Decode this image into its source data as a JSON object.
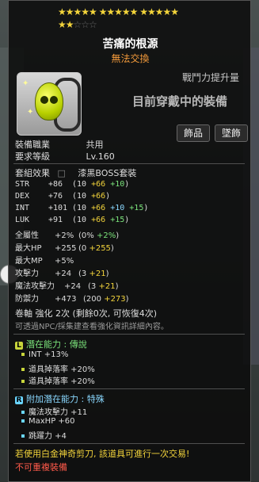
{
  "stars": {
    "row1": "★★★★★  ★★★★★  ★★★★★",
    "row2_filled": "★★",
    "row2_dim": "☆☆☆"
  },
  "header": {
    "title": "苦痛的根源",
    "subtitle": "無法交換"
  },
  "power": {
    "label": "戰鬥力提升量",
    "status": "目前穿戴中的裝備"
  },
  "tags": [
    "飾品",
    "墜飾"
  ],
  "info": {
    "job_label": "裝備職業",
    "job_value": "共用",
    "level_label": "要求等級",
    "level_value": "Lv.160"
  },
  "set": {
    "label": "套組效果",
    "value": "漆黑BOSS套裝"
  },
  "stats": [
    {
      "name": "STR",
      "main": "+86",
      "paren": "(10",
      "p1": "+66",
      "p2": "+10",
      "p3": "",
      "close": ")"
    },
    {
      "name": "DEX",
      "main": "+76",
      "paren": "(10",
      "p1": "+66",
      "p2": "",
      "p3": "",
      "close": ")"
    },
    {
      "name": "INT",
      "main": "+101",
      "paren": "(10",
      "p1": "+66",
      "p2": "+10",
      "p3": "+15",
      "close": ")"
    },
    {
      "name": "LUK",
      "main": "+91",
      "paren": "(10",
      "p1": "+66",
      "p2": "+15",
      "p3": "",
      "close": ")"
    }
  ],
  "stats2": [
    {
      "name": "全屬性",
      "main": "+2%",
      "paren": "(0%",
      "extra": "+2%",
      "close": ")"
    },
    {
      "name": "最大HP",
      "main": "+255",
      "paren": "(0",
      "extra": "+255",
      "close": ")"
    },
    {
      "name": "最大MP",
      "main": "+5%",
      "paren": "",
      "extra": "",
      "close": ""
    },
    {
      "name": "攻擊力",
      "main": "+24",
      "paren": "(3",
      "extra": "+21",
      "close": ")"
    },
    {
      "name": "魔法攻擊力",
      "main": "+24",
      "paren": "(3",
      "extra": "+21",
      "close": ")"
    },
    {
      "name": "防禦力",
      "main": "+473",
      "paren": "(200",
      "extra": "+273",
      "close": ")"
    }
  ],
  "scroll": {
    "text": "卷軸 強化 2次 (剩餘0次, 可恢復4次)",
    "note": "可透過NPC/採集建查看強化資訊詳細內容。"
  },
  "potential": {
    "label": "潛在能力 : 傳說",
    "lines": [
      "INT +13%",
      "道具掉落率 +20%",
      "道具掉落率 +20%"
    ]
  },
  "additional": {
    "label": "附加潛在能力 : 特殊",
    "lines": [
      "魔法攻擊力 +11",
      "MaxHP +60",
      "跳躍力 +4"
    ]
  },
  "footer": {
    "warn": "若使用白金神奇剪刀, 該道具可進行一次交易!",
    "red": "不可重複裝備"
  },
  "colors": {
    "gold": "#f3d43b",
    "green": "#7be37b",
    "orange": "#f39a3b",
    "red": "#ff5a4a",
    "legend_badge": "#c8d53b",
    "unique_badge": "#6ad6ff"
  }
}
